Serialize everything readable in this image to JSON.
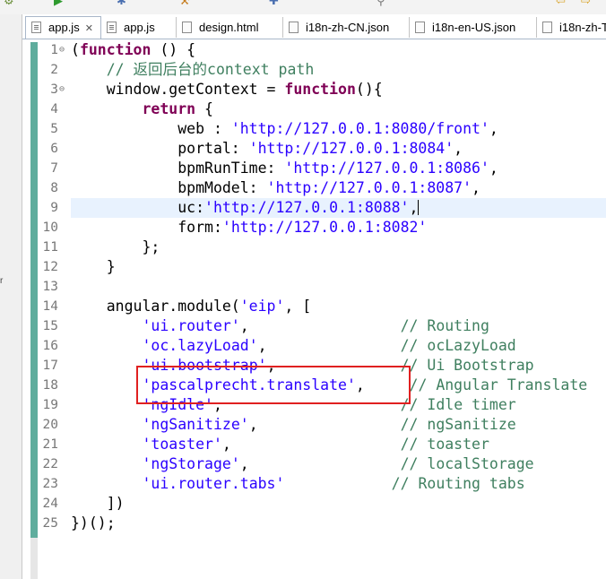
{
  "toolbar": {
    "icons": [
      "build-icon",
      "run-icon",
      "debug-icon",
      "external-tools-icon",
      "new-icon",
      "search-icon",
      "navigate-back-icon",
      "navigate-forward-icon"
    ]
  },
  "tabs": [
    {
      "label": "app.js",
      "active": true,
      "closable": true
    },
    {
      "label": "app.js",
      "active": false,
      "closable": false
    },
    {
      "label": "design.html",
      "active": false,
      "closable": false
    },
    {
      "label": "i18n-zh-CN.json",
      "active": false,
      "closable": false
    },
    {
      "label": "i18n-en-US.json",
      "active": false,
      "closable": false
    },
    {
      "label": "i18n-zh-T",
      "active": false,
      "closable": false
    }
  ],
  "editor": {
    "current_line": 9,
    "highlighted_line": 18,
    "lines": [
      {
        "n": "1",
        "fold": "⊖",
        "tokens": [
          {
            "t": "(",
            "c": ""
          },
          {
            "t": "function",
            "c": "kw"
          },
          {
            "t": " () {",
            "c": ""
          }
        ]
      },
      {
        "n": "2",
        "fold": "",
        "tokens": [
          {
            "t": "    ",
            "c": ""
          },
          {
            "t": "// 返回后台的context path",
            "c": "cmt"
          }
        ]
      },
      {
        "n": "3",
        "fold": "⊖",
        "tokens": [
          {
            "t": "    window.getContext = ",
            "c": ""
          },
          {
            "t": "function",
            "c": "kw"
          },
          {
            "t": "(){",
            "c": ""
          }
        ]
      },
      {
        "n": "4",
        "fold": "",
        "tokens": [
          {
            "t": "        ",
            "c": ""
          },
          {
            "t": "return",
            "c": "kw"
          },
          {
            "t": " {",
            "c": ""
          }
        ]
      },
      {
        "n": "5",
        "fold": "",
        "tokens": [
          {
            "t": "            web : ",
            "c": ""
          },
          {
            "t": "'http://127.0.0.1:8080/front'",
            "c": "str"
          },
          {
            "t": ",",
            "c": ""
          }
        ]
      },
      {
        "n": "6",
        "fold": "",
        "tokens": [
          {
            "t": "            portal: ",
            "c": ""
          },
          {
            "t": "'http://127.0.0.1:8084'",
            "c": "str"
          },
          {
            "t": ",",
            "c": ""
          }
        ]
      },
      {
        "n": "7",
        "fold": "",
        "tokens": [
          {
            "t": "            bpmRunTime: ",
            "c": ""
          },
          {
            "t": "'http://127.0.0.1:8086'",
            "c": "str"
          },
          {
            "t": ",",
            "c": ""
          }
        ]
      },
      {
        "n": "8",
        "fold": "",
        "tokens": [
          {
            "t": "            bpmModel: ",
            "c": ""
          },
          {
            "t": "'http://127.0.0.1:8087'",
            "c": "str"
          },
          {
            "t": ",",
            "c": ""
          }
        ]
      },
      {
        "n": "9",
        "fold": "",
        "tokens": [
          {
            "t": "            uc:",
            "c": ""
          },
          {
            "t": "'http://127.0.0.1:8088'",
            "c": "str"
          },
          {
            "t": ",",
            "c": ""
          }
        ]
      },
      {
        "n": "10",
        "fold": "",
        "tokens": [
          {
            "t": "            form:",
            "c": ""
          },
          {
            "t": "'http://127.0.0.1:8082'",
            "c": "str"
          }
        ]
      },
      {
        "n": "11",
        "fold": "",
        "tokens": [
          {
            "t": "        };",
            "c": ""
          }
        ]
      },
      {
        "n": "12",
        "fold": "",
        "tokens": [
          {
            "t": "    }",
            "c": ""
          }
        ]
      },
      {
        "n": "13",
        "fold": "",
        "tokens": []
      },
      {
        "n": "14",
        "fold": "",
        "tokens": [
          {
            "t": "    angular.module(",
            "c": ""
          },
          {
            "t": "'eip'",
            "c": "str"
          },
          {
            "t": ", [",
            "c": ""
          }
        ]
      },
      {
        "n": "15",
        "fold": "",
        "tokens": [
          {
            "t": "        ",
            "c": ""
          },
          {
            "t": "'ui.router'",
            "c": "str"
          },
          {
            "t": ",                 ",
            "c": ""
          },
          {
            "t": "// Routing",
            "c": "cmt"
          }
        ]
      },
      {
        "n": "16",
        "fold": "",
        "tokens": [
          {
            "t": "        ",
            "c": ""
          },
          {
            "t": "'oc.lazyLoad'",
            "c": "str"
          },
          {
            "t": ",               ",
            "c": ""
          },
          {
            "t": "// ocLazyLoad",
            "c": "cmt"
          }
        ]
      },
      {
        "n": "17",
        "fold": "",
        "tokens": [
          {
            "t": "        ",
            "c": ""
          },
          {
            "t": "'ui.bootstrap'",
            "c": "str"
          },
          {
            "t": ",              ",
            "c": ""
          },
          {
            "t": "// Ui Bootstrap",
            "c": "cmt"
          }
        ]
      },
      {
        "n": "18",
        "fold": "",
        "tokens": [
          {
            "t": "        ",
            "c": ""
          },
          {
            "t": "'pascalprecht.translate'",
            "c": "str"
          },
          {
            "t": ",     ",
            "c": ""
          },
          {
            "t": "// Angular Translate",
            "c": "cmt"
          }
        ]
      },
      {
        "n": "19",
        "fold": "",
        "tokens": [
          {
            "t": "        ",
            "c": ""
          },
          {
            "t": "'ngIdle'",
            "c": "str"
          },
          {
            "t": ",                    ",
            "c": ""
          },
          {
            "t": "// Idle timer",
            "c": "cmt"
          }
        ]
      },
      {
        "n": "20",
        "fold": "",
        "tokens": [
          {
            "t": "        ",
            "c": ""
          },
          {
            "t": "'ngSanitize'",
            "c": "str"
          },
          {
            "t": ",                ",
            "c": ""
          },
          {
            "t": "// ngSanitize",
            "c": "cmt"
          }
        ]
      },
      {
        "n": "21",
        "fold": "",
        "tokens": [
          {
            "t": "        ",
            "c": ""
          },
          {
            "t": "'toaster'",
            "c": "str"
          },
          {
            "t": ",                   ",
            "c": ""
          },
          {
            "t": "// toaster",
            "c": "cmt"
          }
        ]
      },
      {
        "n": "22",
        "fold": "",
        "tokens": [
          {
            "t": "        ",
            "c": ""
          },
          {
            "t": "'ngStorage'",
            "c": "str"
          },
          {
            "t": ",                 ",
            "c": ""
          },
          {
            "t": "// localStorage",
            "c": "cmt"
          }
        ]
      },
      {
        "n": "23",
        "fold": "",
        "tokens": [
          {
            "t": "        ",
            "c": ""
          },
          {
            "t": "'ui.router.tabs'",
            "c": "str"
          },
          {
            "t": "            ",
            "c": ""
          },
          {
            "t": "// Routing tabs",
            "c": "cmt"
          }
        ]
      },
      {
        "n": "24",
        "fold": "",
        "tokens": [
          {
            "t": "    ])",
            "c": ""
          }
        ]
      },
      {
        "n": "25",
        "fold": "",
        "tokens": [
          {
            "t": "})();",
            "c": ""
          }
        ]
      }
    ]
  },
  "colors": {
    "keyword": "#7f0055",
    "string": "#2a00ff",
    "comment": "#3f7f5f",
    "current_line_bg": "#e8f2fe",
    "annotation_box": "#e02020",
    "gutter_change_bar": "#5fad9d"
  },
  "leftpane": {
    "mark": "r"
  }
}
